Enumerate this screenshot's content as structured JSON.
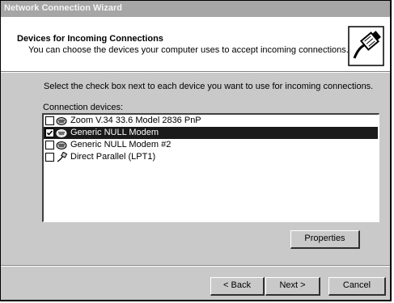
{
  "window": {
    "title": "Network Connection Wizard"
  },
  "header": {
    "title": "Devices for Incoming Connections",
    "subtitle": "You can choose the devices your computer uses to accept incoming connections.",
    "icon": "network-plug-icon"
  },
  "instruction": "Select the check box next to each device you want to use for incoming connections.",
  "devices_label": "Connection devices:",
  "devices": [
    {
      "label": "Zoom V.34 33.6 Model 2836 PnP",
      "checked": false,
      "selected": false,
      "icon": "modem-icon"
    },
    {
      "label": "Generic NULL Modem",
      "checked": true,
      "selected": true,
      "icon": "modem-icon"
    },
    {
      "label": "Generic NULL Modem #2",
      "checked": false,
      "selected": false,
      "icon": "modem-icon"
    },
    {
      "label": "Direct Parallel (LPT1)",
      "checked": false,
      "selected": false,
      "icon": "parallel-cable-icon"
    }
  ],
  "buttons": {
    "properties": "Properties",
    "back": "< Back",
    "next": "Next >",
    "cancel": "Cancel"
  },
  "colors": {
    "title_bar": "#a6a6a6",
    "selection": "#1a1a1a",
    "dialog_face": "#c9c9c9"
  }
}
